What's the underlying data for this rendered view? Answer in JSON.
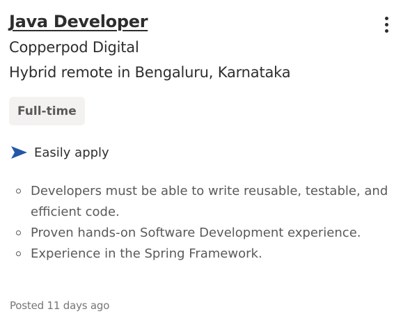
{
  "job": {
    "title": "Java Developer",
    "company": "Copperpod Digital",
    "location": "Hybrid remote in Bengaluru, Karnataka",
    "job_type": "Full-time",
    "easily_apply_label": "Easily apply",
    "easily_apply_icon": "send-arrow-icon",
    "snippet": [
      "Developers must be able to write reusable, testable, and efficient code.",
      "Proven hands-on Software Development experience.",
      "Experience in the Spring Framework."
    ],
    "posted": "Posted 11 days ago",
    "more_icon": "more-vertical-icon"
  },
  "colors": {
    "text_primary": "#2d2d2d",
    "text_secondary": "#595959",
    "text_muted": "#767676",
    "badge_bg": "#f3f2f1",
    "accent": "#2557a7"
  }
}
